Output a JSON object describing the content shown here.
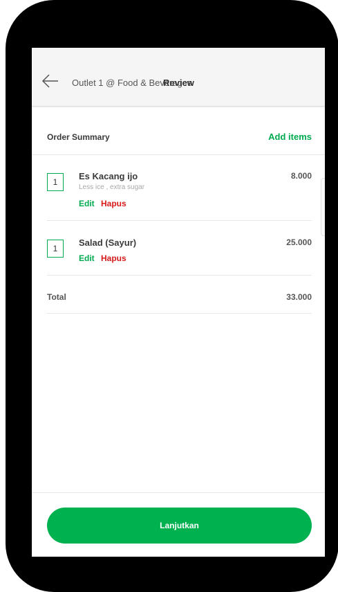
{
  "header": {
    "back_icon": "arrow-left-icon",
    "outlet_name": "Outlet 1 @ Food & Beverages",
    "title": "Review"
  },
  "summary": {
    "title": "Order Summary",
    "add_items_label": "Add items",
    "accent_color": "#00aa4f"
  },
  "items": [
    {
      "quantity": "1",
      "name": "Es Kacang ijo",
      "note": "Less ice , extra sugar",
      "price": "8.000",
      "edit_label": "Edit",
      "delete_label": "Hapus"
    },
    {
      "quantity": "1",
      "name": "Salad (Sayur)",
      "price": "25.000",
      "edit_label": "Edit",
      "delete_label": "Hapus"
    }
  ],
  "total": {
    "label": "Total",
    "value": "33.000"
  },
  "footer": {
    "continue_label": "Lanjutkan",
    "button_color": "#00b14f"
  },
  "colors": {
    "delete": "#d71a1a",
    "phone_frame": "#000000"
  }
}
